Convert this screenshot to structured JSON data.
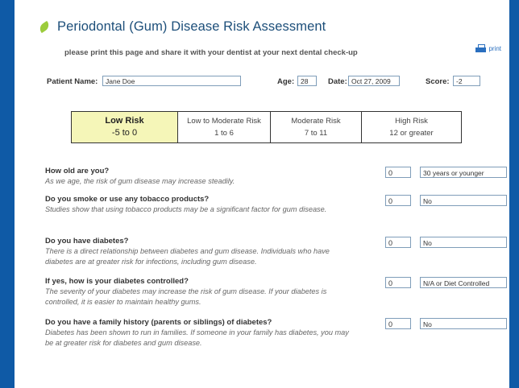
{
  "title": "Periodontal (Gum) Disease Risk Assessment",
  "subtitle": "please print this page and share it with your dentist at your next dental check-up",
  "print_label": "print",
  "patient": {
    "name_label": "Patient Name:",
    "name_value": "Jane Doe",
    "age_label": "Age:",
    "age_value": "28",
    "date_label": "Date:",
    "date_value": "Oct 27, 2009",
    "score_label": "Score:",
    "score_value": "-2"
  },
  "risk_levels": [
    {
      "label": "Low Risk",
      "range": "-5 to 0",
      "active": true
    },
    {
      "label": "Low to Moderate Risk",
      "range": "1 to 6",
      "active": false
    },
    {
      "label": "Moderate Risk",
      "range": "7 to 11",
      "active": false
    },
    {
      "label": "High Risk",
      "range": "12 or greater",
      "active": false
    }
  ],
  "questions": [
    {
      "question": "How old are you?",
      "desc": "As we age, the risk of gum disease may increase steadily.",
      "score": "0",
      "answer": "30 years or younger"
    },
    {
      "question": "Do you smoke or use any tobacco products?",
      "desc": "Studies show that using tobacco products may be a significant factor for gum disease.",
      "score": "0",
      "answer": "No"
    },
    {
      "question": "Do you have diabetes?",
      "desc": "There is a direct relationship between diabetes and gum disease. Individuals who have diabetes are at greater risk for infections, including gum disease.",
      "score": "0",
      "answer": "No"
    },
    {
      "question": "If yes, how is your diabetes controlled?",
      "desc": "The severity of your diabetes may increase the risk of gum disease. If your diabetes is controlled, it is easier to maintain healthy gums.",
      "score": "0",
      "answer": "N/A or Diet Controlled"
    },
    {
      "question": "Do you have a family history (parents or siblings) of diabetes?",
      "desc": "Diabetes has been shown to run in families. If someone in your family has diabetes, you may be at greater risk for diabetes and gum disease.",
      "score": "0",
      "answer": "No"
    }
  ]
}
